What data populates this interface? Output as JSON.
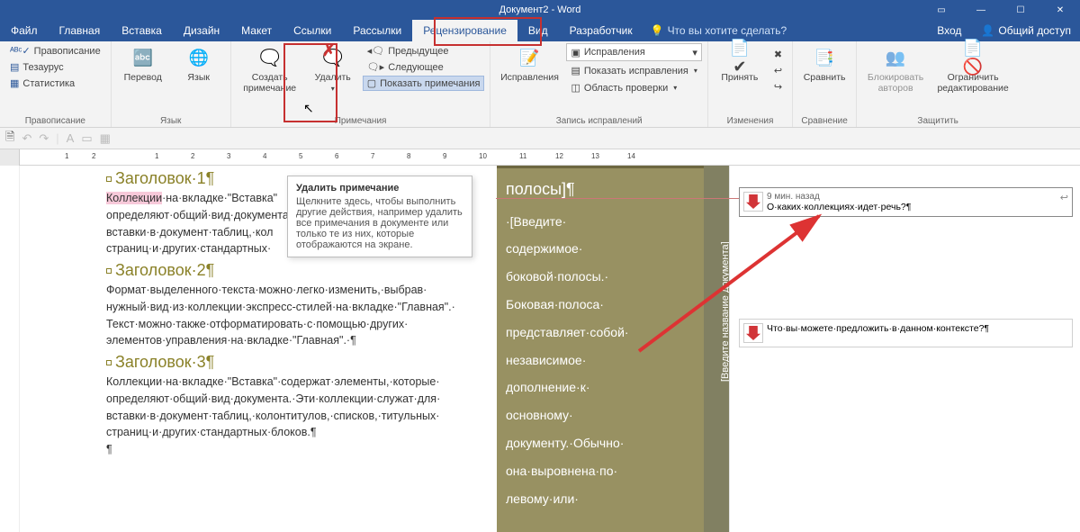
{
  "window": {
    "title": "Документ2 - Word",
    "signin": "Вход",
    "share": "Общий доступ"
  },
  "tabs": {
    "file": "Файл",
    "home": "Главная",
    "insert": "Вставка",
    "design": "Дизайн",
    "layout": "Макет",
    "refs": "Ссылки",
    "mail": "Рассылки",
    "review": "Рецензирование",
    "view": "Вид",
    "dev": "Разработчик",
    "tellme": "Что вы хотите сделать?"
  },
  "ribbon": {
    "proofing": {
      "label": "Правописание",
      "spell": "Правописание",
      "thes": "Тезаурус",
      "stats": "Статистика"
    },
    "language": {
      "label": "Язык",
      "translate": "Перевод",
      "lang": "Язык"
    },
    "comments": {
      "label": "Примечания",
      "new": "Создать\nпримечание",
      "delete": "Удалить",
      "prev": "Предыдущее",
      "next": "Следующее",
      "show": "Показать примечания"
    },
    "tracking": {
      "label": "Запись исправлений",
      "track": "Исправления",
      "display": "Исправления",
      "markup": "Показать исправления",
      "pane": "Область проверки"
    },
    "changes": {
      "label": "Изменения",
      "accept": "Принять"
    },
    "compare": {
      "label": "Сравнение",
      "compare": "Сравнить"
    },
    "protect": {
      "label": "Защитить",
      "block": "Блокировать\nавторов",
      "restrict": "Ограничить\nредактирование"
    }
  },
  "tooltip": {
    "title": "Удалить примечание",
    "body": "Щелкните здесь, чтобы выполнить другие действия, например удалить все примечания в документе или только те из них, которые отображаются на экране."
  },
  "doc": {
    "h1": "Заголовок·1¶",
    "p1a": "Коллекции",
    "p1b": "·на·вкладке·\"Вставка\"\nопределяют·общий·вид·документа\nвставки·в·документ·таблиц,·кол\nстраниц·и·других·стандартных·",
    "h2": "Заголовок·2¶",
    "p2": "Формат·выделенного·текста·можно·легко·изменить,·выбрав·\nнужный·вид·из·коллекции·экспресс-стилей·на·вкладке·\"Главная\".·\nТекст·можно·также·отформатировать·с·помощью·других·\nэлементов·управления·на·вкладке·\"Главная\".·¶",
    "h3": "Заголовок·3¶",
    "p3": "Коллекции·на·вкладке·\"Вставка\"·содержат·элементы,·которые·\nопределяют·общий·вид·документа.·Эти·коллекции·служат·для·\nвставки·в·документ·таблиц,·колонтитулов,·списков,·титульных·\nстраниц·и·других·стандартных·блоков.¶",
    "side_title": "полосы]¶",
    "side_body": "·[Введите·\nсодержимое·\nбоковой·полосы.·\nБоковая·полоса·\nпредставляет·собой·\nнезависимое·\nдополнение·к·\nосновному·\nдокументу.·Обычно·\nона·выровнена·по·\nлевому·или·",
    "rot": "[Введите название документа]"
  },
  "comments": {
    "c1_time": "9 мин. назад",
    "c1_text": "О·каких·коллекциях·идет·речь?¶",
    "c2_text": "Что·вы·можете·предложить·в·данном·контексте?¶"
  },
  "ruler_nums": [
    "1",
    "2",
    "1",
    "2",
    "3",
    "4",
    "5",
    "6",
    "7",
    "8",
    "9",
    "10",
    "11",
    "12",
    "13",
    "14"
  ]
}
